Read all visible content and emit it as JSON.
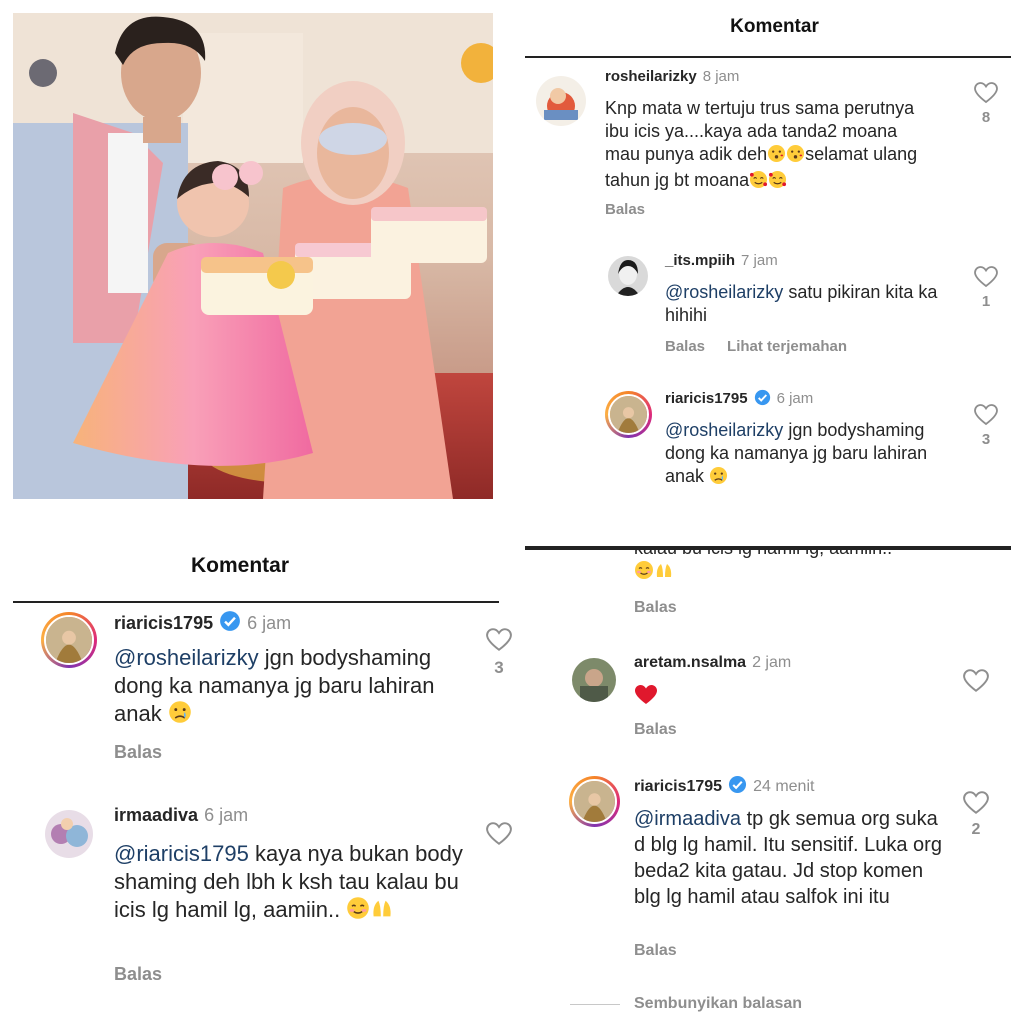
{
  "top_right": {
    "header_title": "Komentar",
    "reply_label": "Balas",
    "translate_label": "Lihat terjemahan",
    "comments": [
      {
        "username": "rosheilarizky",
        "time": "8 jam",
        "text": "Knp mata w tertuju trus sama perutnya ibu icis ya....kaya ada tanda2  moana mau punya adik deh",
        "text_after_emoji": "selamat ulang tahun jg bt moana",
        "likes": "8"
      },
      {
        "username": "_its.mpiih",
        "time": "7 jam",
        "mention": "@rosheilarizky",
        "text": "satu pikiran kita ka hihihi",
        "likes": "1"
      },
      {
        "username": "riaricis1795",
        "time": "6 jam",
        "mention": "@rosheilarizky",
        "text": "jgn bodyshaming dong ka namanya jg baru lahiran anak",
        "likes": "3"
      }
    ]
  },
  "bottom_left": {
    "header_title": "Komentar",
    "reply_label": "Balas",
    "comments": [
      {
        "username": "riaricis1795",
        "time": "6 jam",
        "mention": "@rosheilarizky",
        "text": "jgn bodyshaming dong ka namanya jg baru lahiran anak",
        "likes": "3"
      },
      {
        "username": "irmaadiva",
        "time": "6 jam",
        "mention": "@riaricis1795",
        "text": "kaya nya bukan body shaming deh lbh k ksh tau kalau bu icis lg hamil lg, aamiin.."
      }
    ]
  },
  "bottom_right": {
    "reply_label": "Balas",
    "hide_replies_label": "Sembunyikan balasan",
    "cut_text": "kalau bu icis lg hamil lg, aamiin..",
    "comments": [
      {
        "username": "aretam.nsalma",
        "time": "2 jam"
      },
      {
        "username": "riaricis1795",
        "time": "24 menit",
        "mention": "@irmaadiva",
        "text": "tp gk semua org suka d blg lg hamil. Itu sensitif. Luka org beda2 kita gatau. Jd stop komen blg lg hamil atau salfok ini itu",
        "likes": "2"
      }
    ]
  },
  "colors": {
    "mention": "#1e3f66",
    "verified": "#3897f0",
    "muted": "#8e8e8e",
    "heart_red": "#e0182d"
  },
  "icons": [
    "heart-outline-icon",
    "verified-badge-icon",
    "red-heart-emoji",
    "kissing-face-emoji",
    "smiling-hearts-emoji",
    "crying-face-emoji",
    "blushing-face-emoji",
    "folded-hands-emoji"
  ]
}
